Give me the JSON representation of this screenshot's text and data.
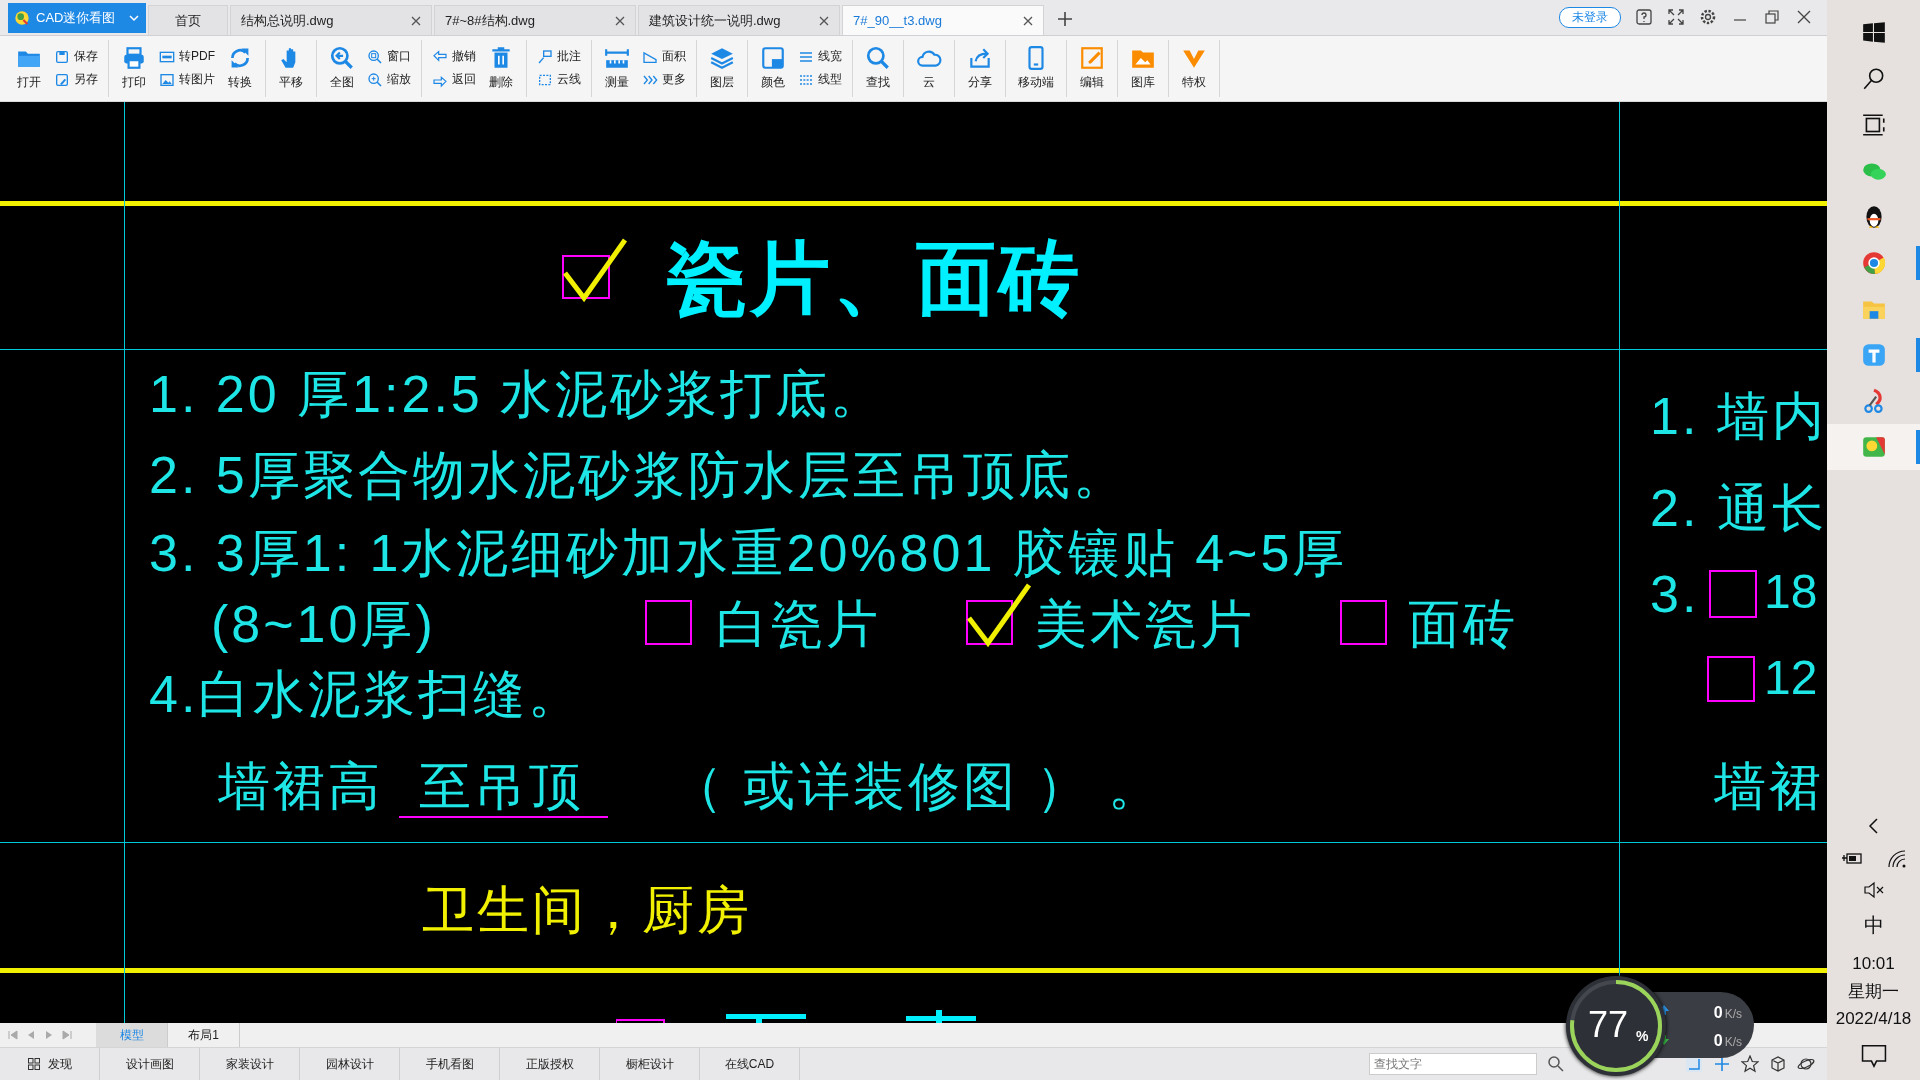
{
  "app_menu": {
    "label": "CAD迷你看图"
  },
  "tabs": [
    {
      "label": "首页",
      "selected": false,
      "closable": false
    },
    {
      "label": "结构总说明.dwg",
      "selected": false,
      "closable": true
    },
    {
      "label": "7#~8#结构.dwg",
      "selected": false,
      "closable": true
    },
    {
      "label": "建筑设计统一说明.dwg",
      "selected": false,
      "closable": true
    },
    {
      "label": "7#_90__t3.dwg",
      "selected": true,
      "closable": true
    }
  ],
  "account": {
    "label": "未登录"
  },
  "toolbar": [
    [
      {
        "label": "打开",
        "kind": "large"
      },
      {
        "label": "保存",
        "kind": "small"
      },
      {
        "label": "另存",
        "kind": "small"
      }
    ],
    [
      {
        "label": "打印",
        "kind": "large"
      },
      {
        "label": "转PDF",
        "kind": "small"
      },
      {
        "label": "转图片",
        "kind": "small"
      },
      {
        "label": "转换",
        "kind": "large"
      }
    ],
    [
      {
        "label": "平移",
        "kind": "large"
      }
    ],
    [
      {
        "label": "全图",
        "kind": "large"
      },
      {
        "label": "窗口",
        "kind": "small"
      },
      {
        "label": "缩放",
        "kind": "small"
      }
    ],
    [
      {
        "label": "撤销",
        "kind": "small"
      },
      {
        "label": "返回",
        "kind": "small"
      },
      {
        "label": "删除",
        "kind": "large"
      }
    ],
    [
      {
        "label": "批注",
        "kind": "small"
      },
      {
        "label": "云线",
        "kind": "small"
      }
    ],
    [
      {
        "label": "测量",
        "kind": "large"
      },
      {
        "label": "面积",
        "kind": "small"
      },
      {
        "label": "更多",
        "kind": "small"
      }
    ],
    [
      {
        "label": "图层",
        "kind": "large"
      }
    ],
    [
      {
        "label": "颜色",
        "kind": "large"
      },
      {
        "label": "线宽",
        "kind": "small"
      },
      {
        "label": "线型",
        "kind": "small"
      }
    ],
    [
      {
        "label": "查找",
        "kind": "large"
      }
    ],
    [
      {
        "label": "云",
        "kind": "large"
      }
    ],
    [
      {
        "label": "分享",
        "kind": "large"
      }
    ],
    [
      {
        "label": "移动端",
        "kind": "large"
      }
    ],
    [
      {
        "label": "编辑",
        "kind": "large"
      }
    ],
    [
      {
        "label": "图库",
        "kind": "large"
      }
    ],
    [
      {
        "label": "特权",
        "kind": "large"
      }
    ]
  ],
  "drawing": {
    "title": {
      "text": "瓷片、面砖",
      "checked": true
    },
    "steps": [
      "1. 20 厚1:2.5 水泥砂浆打底。",
      "2. 5厚聚合物水泥砂浆防水层至吊顶底。",
      "3. 3厚1: 1水泥细砂加水重20%801 胶镶贴 4~5厚"
    ],
    "thickness": "(8~10厚)",
    "finishes": [
      {
        "label": "白瓷片",
        "checked": false
      },
      {
        "label": "美术瓷片",
        "checked": true
      },
      {
        "label": "面砖",
        "checked": false
      }
    ],
    "step_4": "4.白水泥浆扫缝。",
    "dado": {
      "label": "墙裙高",
      "height": "至吊顶",
      "note": "（ 或详装修图 ） 。"
    },
    "room": "卫生间，厨房",
    "right_column": {
      "steps": [
        "1. 墙内",
        "2. 通长",
        "3."
      ],
      "options": [
        {
          "label": "18",
          "checked": false
        },
        {
          "label": "12",
          "checked": false
        }
      ],
      "dado_label": "墙裙"
    }
  },
  "layout_tabs": [
    {
      "label": "模型",
      "selected": true
    },
    {
      "label": "布局1",
      "selected": false
    }
  ],
  "bottom_links": [
    "发现",
    "设计画图",
    "家装设计",
    "园林设计",
    "手机看图",
    "正版授权",
    "橱柜设计",
    "在线CAD"
  ],
  "find": {
    "placeholder": "查找文字"
  },
  "network": {
    "percent": "77",
    "percent_sign": "%",
    "upload": {
      "value": "0",
      "unit": "K/s"
    },
    "download": {
      "value": "0",
      "unit": "K/s"
    }
  },
  "taskbar": {
    "apps": [
      {
        "running": false,
        "selected": false
      },
      {
        "running": false,
        "selected": false
      },
      {
        "running": true,
        "selected": false
      },
      {
        "running": false,
        "selected": false
      },
      {
        "running": true,
        "selected": false
      },
      {
        "running": false,
        "selected": false
      },
      {
        "running": true,
        "selected": true
      }
    ],
    "ime": "中",
    "time": "10:01",
    "weekday": "星期一",
    "date": "2022/4/18"
  }
}
